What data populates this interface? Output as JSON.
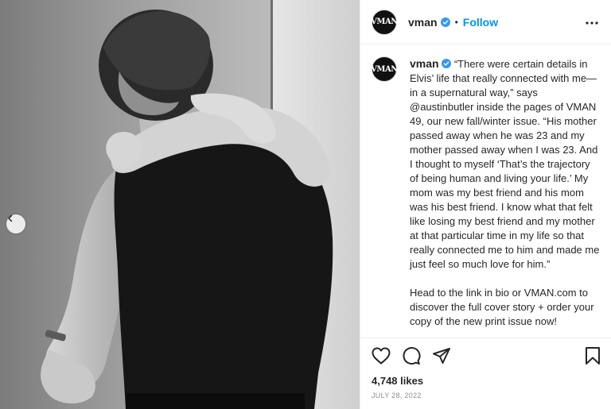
{
  "post": {
    "username": "vman",
    "avatar_text": "VMAN",
    "follow_label": "Follow",
    "separator": "•",
    "caption_paragraphs": [
      "“There were certain details in Elvis’ life that really connected with me—in a supernatural way,” says @austinbutler inside the pages of VMAN 49, our new fall/winter issue. “His mother passed away when he was 23 and my mother passed away when I was 23. And I thought to myself ‘That’s the trajectory of being human and living your life.’ My mom was my best friend and his mom was his best friend. I know what that felt like losing my best friend and my mother at that particular time in my life so that really connected me to him and made me just feel so much love for him.”",
      "Head to the link in bio or VMAN.com to discover the full cover story + order your copy of the new print issue now!"
    ],
    "likes": "4,748 likes",
    "date": "JULY 28, 2022"
  },
  "icons": {
    "verified": "verified-badge-icon",
    "more": "more-options-icon",
    "like": "heart-icon",
    "comment": "comment-icon",
    "share": "paper-plane-icon",
    "save": "bookmark-icon",
    "carousel_prev": "chevron-left-icon"
  },
  "colors": {
    "accent": "#0095f6",
    "text": "#262626",
    "muted": "#8e8e8e"
  }
}
